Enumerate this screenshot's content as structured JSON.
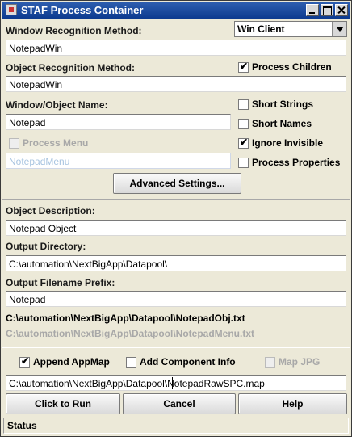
{
  "window": {
    "title": "STAF Process Container"
  },
  "window_recognition": {
    "label": "Window Recognition Method:",
    "value": "NotepadWin",
    "combo_value": "Win Client"
  },
  "object_recognition": {
    "label": "Object Recognition Method:",
    "value": "NotepadWin"
  },
  "window_object_name": {
    "label": "Window/Object Name:",
    "value": "Notepad"
  },
  "process_menu": {
    "label": "Process Menu",
    "value": "NotepadMenu",
    "checked": false,
    "enabled": false
  },
  "options": {
    "process_children": {
      "label": "Process Children",
      "checked": true
    },
    "short_strings": {
      "label": "Short Strings",
      "checked": false
    },
    "short_names": {
      "label": "Short Names",
      "checked": false
    },
    "ignore_invisible": {
      "label": "Ignore Invisible",
      "checked": true
    },
    "process_properties": {
      "label": "Process Properties",
      "checked": false
    }
  },
  "advanced_button": "Advanced Settings...",
  "object_description": {
    "label": "Object Description:",
    "value": "Notepad Object"
  },
  "output_directory": {
    "label": "Output Directory:",
    "value": "C:\\automation\\NextBigApp\\Datapool\\"
  },
  "output_prefix": {
    "label": "Output Filename Prefix:",
    "value": "Notepad"
  },
  "output_files": {
    "obj": "C:\\automation\\NextBigApp\\Datapool\\NotepadObj.txt",
    "menu": "C:\\automation\\NextBigApp\\Datapool\\NotepadMenu.txt"
  },
  "append_appmap": {
    "label": "Append AppMap",
    "checked": true
  },
  "add_component_info": {
    "label": "Add Component Info",
    "checked": false
  },
  "map_jpg": {
    "label": "Map JPG",
    "checked": false,
    "enabled": false
  },
  "appmap_path": "C:\\automation\\NextBigApp\\Datapool\\NotepadRawSPC.map",
  "buttons": {
    "run": "Click to Run",
    "cancel": "Cancel",
    "help": "Help"
  },
  "status": "Status"
}
